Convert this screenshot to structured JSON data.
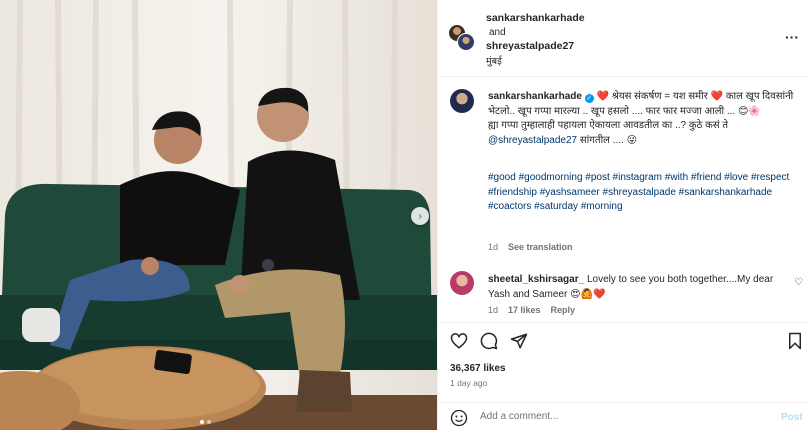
{
  "post": {
    "user1": "sankarshankarhade",
    "and": "and",
    "user2": "shreyastalpade27",
    "location": "मुंबई",
    "more_icon": "more-icon"
  },
  "caption": {
    "username": "sankarshankarhade",
    "line1": "❤️ श्रेयस संकर्षण = यश समीर ❤️ काल खूप दिवसांनी भेटलो.. खूप गप्पा मारल्या .. खूप हसलो .... फार फार मज्जा आली ... 😊🌸",
    "line2": "ह्या गप्पा तुम्हालाही पहायला ऐकायला आवडतील का ..? कुठे कसं ते",
    "mention": "@shreyastalpade27",
    "line3": "सांगतील .... 😜",
    "hashtags": "#good #goodmorning #post #instagram #with #friend #love #respect #friendship #yashsameer #shreyastalpade #sankarshankarhade #coactors #saturday #morning",
    "time": "1d",
    "see_translation": "See translation"
  },
  "comment": {
    "username": "sheetal_kshirsagar_",
    "text": "Lovely to see you both together....My dear Yash and Sameer 😍🙆❤️",
    "time": "1d",
    "likes": "17 likes",
    "reply": "Reply"
  },
  "stats": {
    "likes": "36,367 likes",
    "ago": "1 day ago"
  },
  "composer": {
    "placeholder": "Add a comment...",
    "post_label": "Post"
  },
  "colors": {
    "link": "#00376b",
    "meta": "#737373",
    "verified": "#0095f6",
    "post_disabled": "#b2dffc"
  }
}
